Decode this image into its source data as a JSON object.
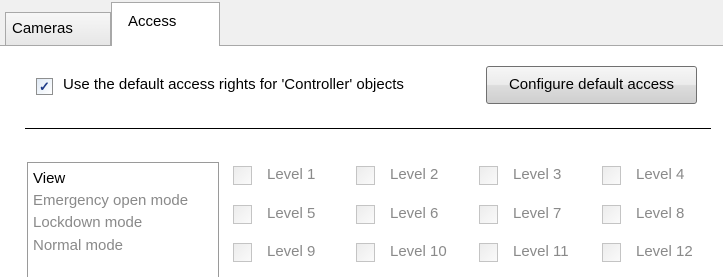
{
  "tabs": [
    {
      "label": "Cameras",
      "active": false
    },
    {
      "label": "Access",
      "active": true
    }
  ],
  "default_access": {
    "checked": true,
    "label": "Use the default access rights for 'Controller' objects",
    "button_label": "Configure default access"
  },
  "modes": [
    {
      "label": "View",
      "selected": true
    },
    {
      "label": "Emergency open mode",
      "selected": false
    },
    {
      "label": "Lockdown mode",
      "selected": false
    },
    {
      "label": "Normal mode",
      "selected": false
    }
  ],
  "levels": [
    {
      "label": "Level 1",
      "checked": false
    },
    {
      "label": "Level 2",
      "checked": false
    },
    {
      "label": "Level 3",
      "checked": false
    },
    {
      "label": "Level 4",
      "checked": false
    },
    {
      "label": "Level 5",
      "checked": false
    },
    {
      "label": "Level 6",
      "checked": false
    },
    {
      "label": "Level 7",
      "checked": false
    },
    {
      "label": "Level 8",
      "checked": false
    },
    {
      "label": "Level 9",
      "checked": false
    },
    {
      "label": "Level 10",
      "checked": false
    },
    {
      "label": "Level 11",
      "checked": false
    },
    {
      "label": "Level 12",
      "checked": false
    }
  ]
}
